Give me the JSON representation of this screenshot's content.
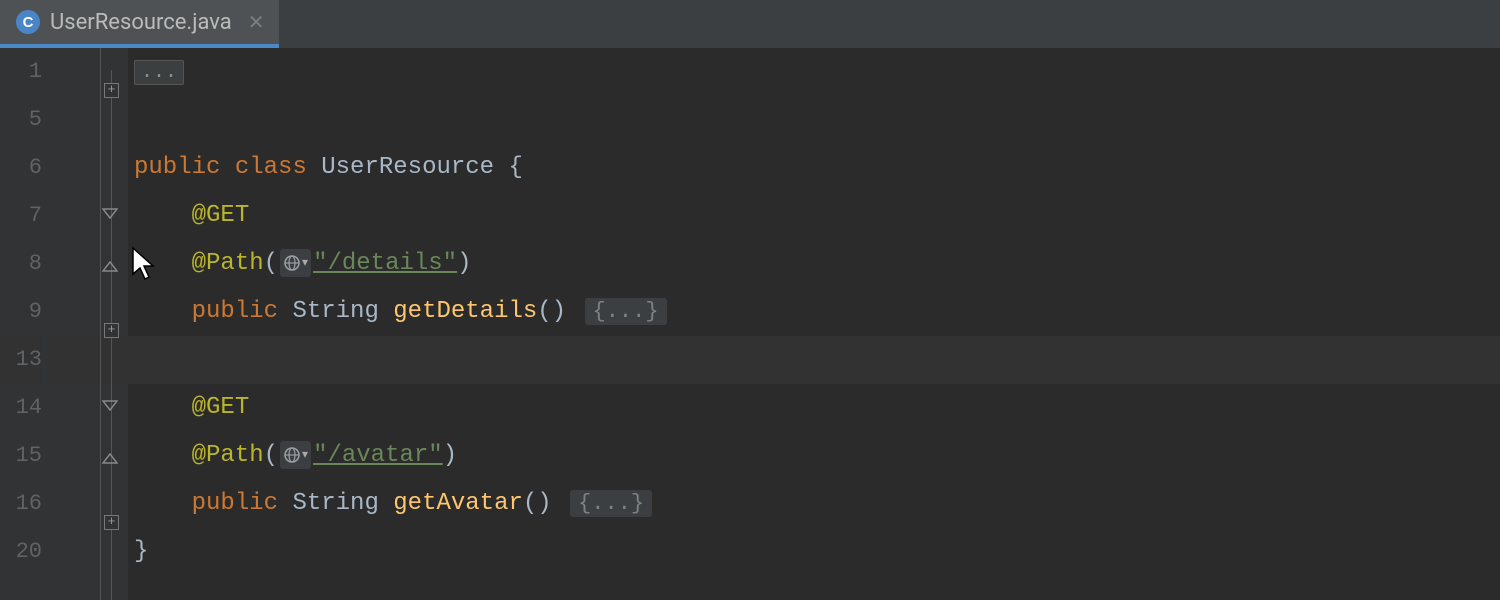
{
  "tab": {
    "filename": "UserResource.java",
    "icon_letter": "C"
  },
  "line_numbers": [
    "1",
    "5",
    "6",
    "7",
    "8",
    "9",
    "13",
    "14",
    "15",
    "16",
    "20"
  ],
  "code": {
    "kw_public": "public",
    "kw_class": "class",
    "class_name": "UserResource",
    "lbrace": "{",
    "rbrace": "}",
    "ann_get": "@GET",
    "ann_path": "@Path",
    "lparen": "(",
    "rparen": ")",
    "str_details": "\"/details\"",
    "str_avatar": "\"/avatar\"",
    "type_string": "String",
    "m_getDetails": "getDetails",
    "m_getAvatar": "getAvatar",
    "empty_parens": "()",
    "folded_top": "...",
    "folded_body": "{...}"
  }
}
